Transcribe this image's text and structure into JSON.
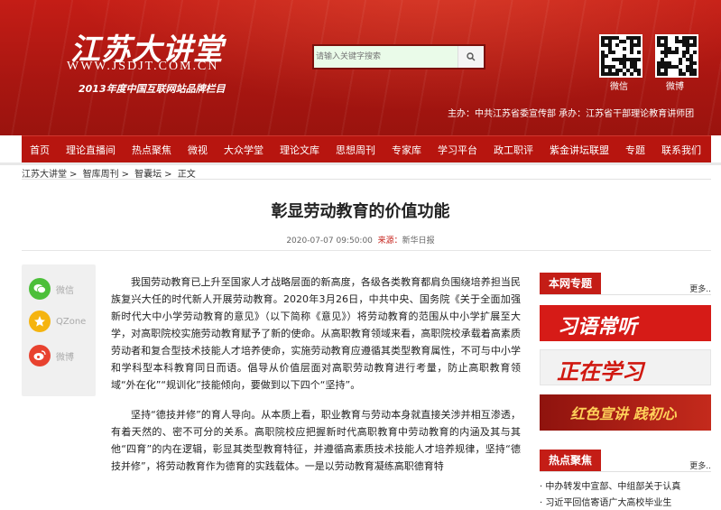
{
  "header": {
    "logo_main": "江苏大讲堂",
    "logo_url": "WWW.JSDJT.COM.CN",
    "logo_sub": "2013年度中国互联网站品牌栏目",
    "search_placeholder": "请输入关键字搜索",
    "qr_items": [
      {
        "label": "微信"
      },
      {
        "label": "微博"
      }
    ],
    "sponsor": "主办：中共江苏省委宣传部  承办：江苏省干部理论教育讲师团"
  },
  "nav": [
    "首页",
    "理论直播间",
    "热点聚焦",
    "微视",
    "大众学堂",
    "理论文库",
    "思想周刊",
    "专家库",
    "学习平台",
    "政工职评",
    "紫金讲坛联盟",
    "专题",
    "联系我们"
  ],
  "breadcrumb": [
    "江苏大讲堂",
    "智库周刊",
    "智囊坛",
    "正文"
  ],
  "article": {
    "title": "彰显劳动教育的价值功能",
    "date": "2020-07-07 09:50:00",
    "source_label": "来源：",
    "source": "新华日报",
    "paragraphs": [
      "我国劳动教育已上升至国家人才战略层面的新高度，各级各类教育都肩负围绕培养担当民族复兴大任的时代新人开展劳动教育。2020年3月26日，中共中央、国务院《关于全面加强新时代大中小学劳动教育的意见》（以下简称《意见》）将劳动教育的范围从中小学扩展至大学，对高职院校实施劳动教育赋予了新的使命。从高职教育领域来看，高职院校承载着高素质劳动者和复合型技术技能人才培养使命，实施劳动教育应遵循其类型教育属性，不可与中小学和学科型本科教育同日而语。倡导从价值层面对高职劳动教育进行考量，防止高职教育领域“外在化”“规训化”技能倾向，要做到以下四个“坚持”。",
      "坚持“德技并修”的育人导向。从本质上看，职业教育与劳动本身就直接关涉并相互渗透，有着天然的、密不可分的关系。高职院校应把握新时代高职教育中劳动教育的内涵及其与其他“四育”的内在逻辑，彰显其类型教育特征，并遵循高素质技术技能人才培养规律，坚持“德技并修”，将劳动教育作为德育的实践载体。一是以劳动教育凝练高职德育特"
    ]
  },
  "share": [
    {
      "label": "微信",
      "icon": "wechat-icon",
      "color": "#4cbf3a"
    },
    {
      "label": "QZone",
      "icon": "qzone-icon",
      "color": "#f5b40f"
    },
    {
      "label": "微博",
      "icon": "weibo-icon",
      "color": "#e8422f"
    }
  ],
  "sidebar": {
    "topics_title": "本网专题",
    "hot_title": "热点聚焦",
    "more": "更多..",
    "banners": [
      {
        "text": "习语常听",
        "bg": "#d61b17"
      },
      {
        "text": "正在学习",
        "bg": "#f2f2f2"
      },
      {
        "text": "红色宣讲 践初心",
        "bg": "#a61a14"
      }
    ],
    "hot_news": [
      "· 中办转发中宣部、中组部关于认真",
      "· 习近平回信寄语广大高校毕业生"
    ]
  },
  "colors": {
    "brand_red": "#c41d16",
    "nav_red": "#b7150f"
  }
}
